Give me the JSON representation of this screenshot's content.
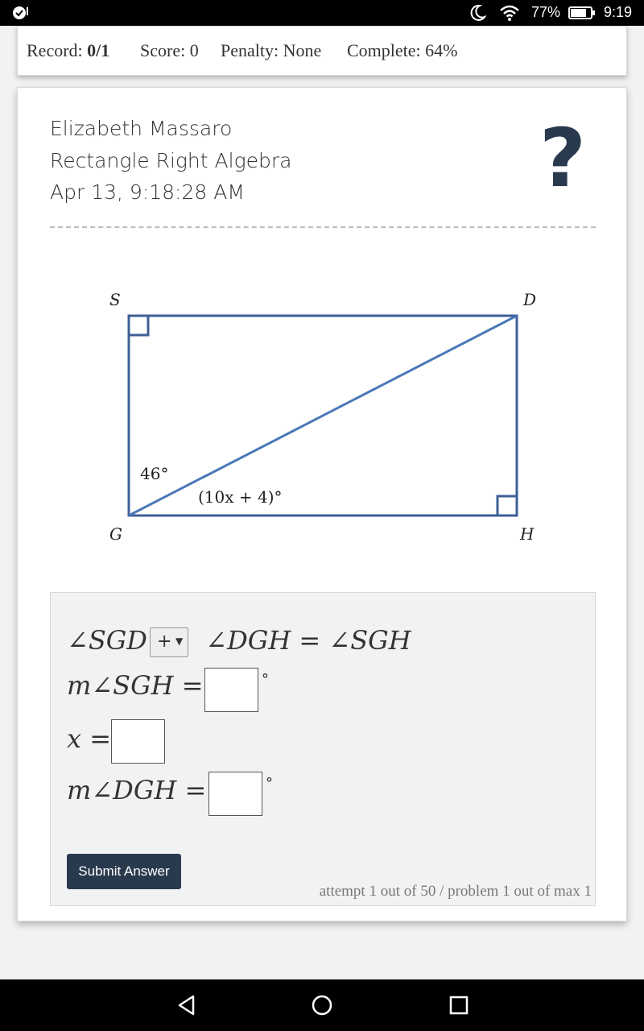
{
  "status_bar": {
    "battery": "77%",
    "time": "9:19",
    "icons": [
      "app-notification-icon",
      "moon-icon",
      "wifi-icon",
      "battery-icon"
    ]
  },
  "record": {
    "record_label": "Record:",
    "record_value": "0/1",
    "score": "Score: 0",
    "penalty": "Penalty: None",
    "complete": "Complete: 64%"
  },
  "header": {
    "student": "Elizabeth Massaro",
    "problem": "Rectangle Right Algebra",
    "timestamp": "Apr 13, 9:18:28 AM",
    "help_icon": "question-mark-icon"
  },
  "figure": {
    "vertices": {
      "top_left": "S",
      "top_right": "D",
      "bottom_left": "G",
      "bottom_right": "H"
    },
    "angle_label_1": "46°",
    "angle_label_2": "(10x + 4)°",
    "stroke_color": "#3d5f95",
    "diagonal_color": "#4a78b8"
  },
  "answer": {
    "row1_left": "∠SGD",
    "row1_op": "+",
    "row1_right": "∠DGH = ∠SGH",
    "row2_label": "m∠SGH =",
    "row3_label": "x =",
    "row4_label": "m∠DGH =",
    "degree": "°",
    "submit": "Submit Answer",
    "attempt": "attempt 1 out of 50 / problem 1 out of max 1"
  },
  "colors": {
    "accent": "#2a3a4e"
  }
}
